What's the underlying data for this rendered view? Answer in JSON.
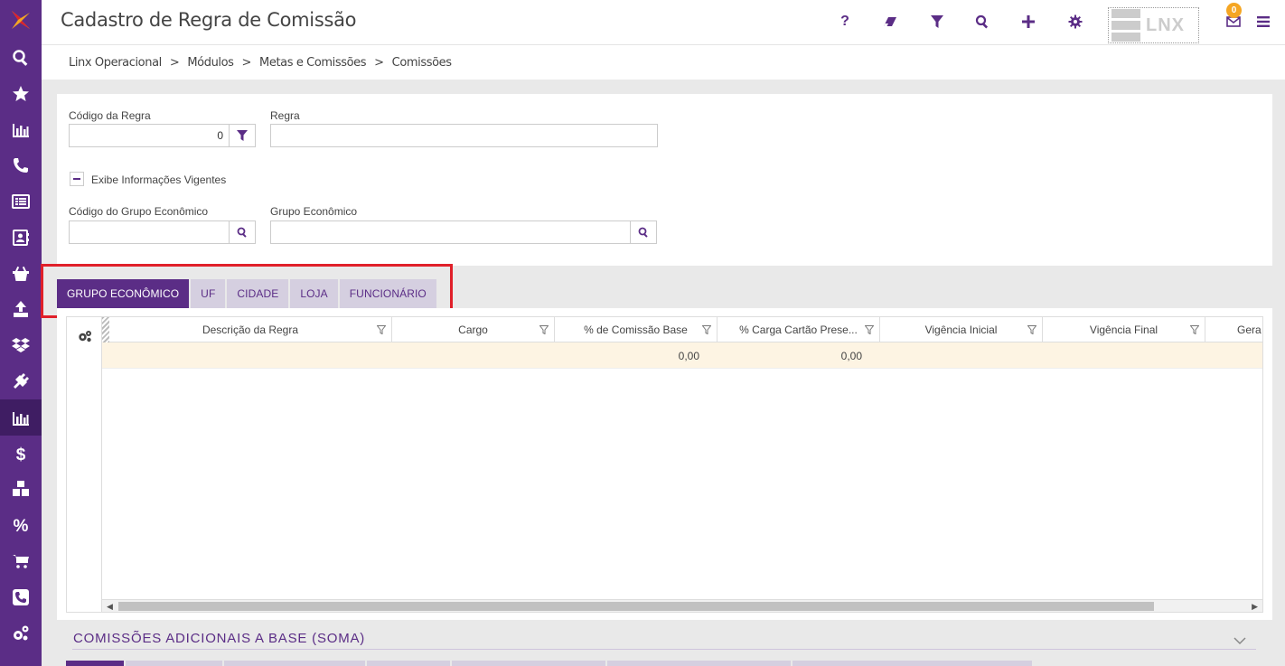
{
  "app": {
    "title": "Cadastro de Regra de Comissão",
    "logo_text": "LNX",
    "notification_count": "0",
    "help_label": "?"
  },
  "breadcrumb": [
    "Linx Operacional",
    "Módulos",
    "Metas e Comissões",
    "Comissões"
  ],
  "breadcrumb_sep": ">",
  "sidebar": {
    "items": [
      "search-icon",
      "star-icon",
      "bar-chart-icon",
      "phone-icon",
      "list-icon",
      "contact-card-icon",
      "basket-icon",
      "upload-icon",
      "dropbox-icon",
      "plug-icon",
      "bar-chart-icon",
      "dollar-icon",
      "cubes-icon",
      "percent-icon",
      "cart-icon",
      "phone-square-icon",
      "gears-icon"
    ],
    "active_index": 10
  },
  "form": {
    "codigo_regra_label": "Código da Regra",
    "codigo_regra_value": "0",
    "regra_label": "Regra",
    "regra_value": "",
    "exibe_label": "Exibe Informações Vigentes",
    "codigo_grupo_label": "Código do Grupo Econômico",
    "codigo_grupo_value": "",
    "grupo_label": "Grupo Econômico",
    "grupo_value": ""
  },
  "tabs": [
    "GRUPO ECONÔMICO",
    "UF",
    "CIDADE",
    "LOJA",
    "FUNCIONÁRIO"
  ],
  "active_tab": 0,
  "grid": {
    "columns": [
      "Descrição da Regra",
      "Cargo",
      "% de Comissão Base",
      "% Carga Cartão Prese...",
      "Vigência Inicial",
      "Vigência Final",
      "Gera"
    ],
    "rows": [
      {
        "descricao": "",
        "cargo": "",
        "comissao_base": "0,00",
        "carga_cartao": "0,00",
        "vigencia_inicial": "",
        "vigencia_final": ""
      }
    ]
  },
  "section": {
    "title": "COMISSÕES ADICIONAIS A BASE (SOMA)"
  },
  "colors": {
    "primary": "#5b2d86",
    "sidebar_active": "#3f1d63",
    "tab_inactive": "#d5cfe0",
    "highlight": "#e0202a",
    "row_highlight": "#fdf4e3"
  }
}
